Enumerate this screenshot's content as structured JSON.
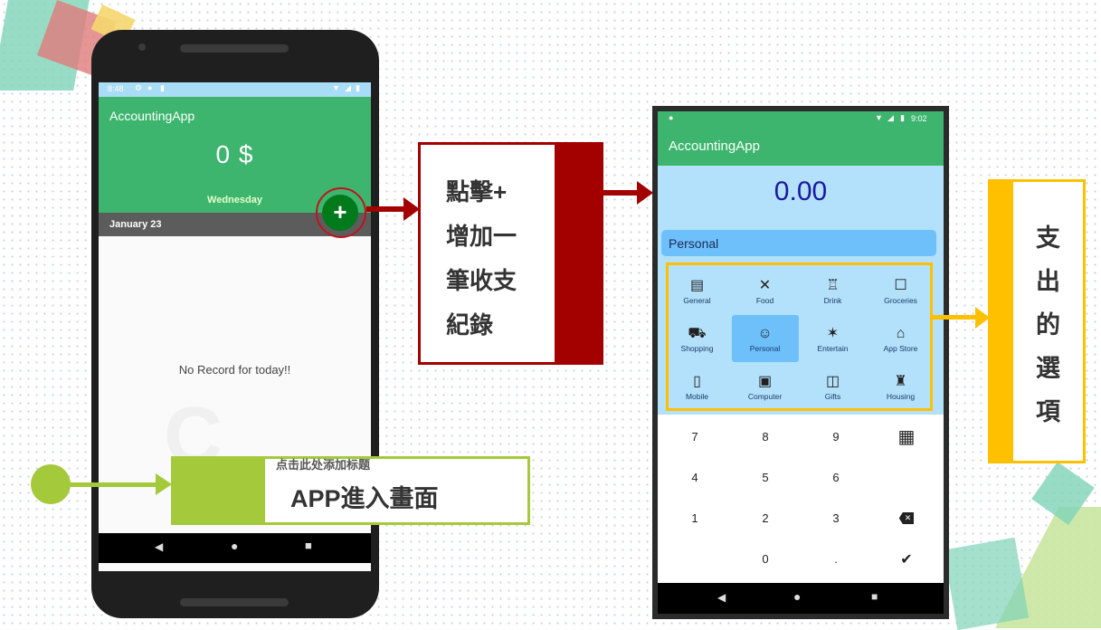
{
  "phone1": {
    "status_time": "8:48",
    "app_title": "AccountingApp",
    "amount": "0 $",
    "weekday": "Wednesday",
    "date": "January 23",
    "fab_label": "+",
    "empty_text": "No Record for today!!"
  },
  "callout_plus": {
    "lines": [
      "點擊+",
      "增加一",
      "筆收支",
      "紀錄"
    ]
  },
  "callout_enter": {
    "placeholder": "点击此处添加标题",
    "text": "APP進入畫面"
  },
  "phone2": {
    "status_time": "9:02",
    "app_title": "AccountingApp",
    "amount": "0.00",
    "selected_category": "Personal",
    "categories": [
      {
        "label": "General",
        "icon": "newspaper-icon"
      },
      {
        "label": "Food",
        "icon": "utensils-icon"
      },
      {
        "label": "Drink",
        "icon": "drink-icon"
      },
      {
        "label": "Groceries",
        "icon": "box-icon"
      },
      {
        "label": "Shopping",
        "icon": "cart-icon"
      },
      {
        "label": "Personal",
        "icon": "person-icon"
      },
      {
        "label": "Entertain",
        "icon": "sparkle-icon"
      },
      {
        "label": "App Store",
        "icon": "store-icon"
      },
      {
        "label": "Mobile",
        "icon": "mobile-icon"
      },
      {
        "label": "Computer",
        "icon": "computer-icon"
      },
      {
        "label": "Gifts",
        "icon": "gift-icon"
      },
      {
        "label": "Housing",
        "icon": "housing-icon"
      }
    ],
    "keys": [
      "7",
      "8",
      "9",
      "",
      "4",
      "5",
      "6",
      "",
      "1",
      "2",
      "3",
      "",
      "",
      "0",
      ".",
      ""
    ]
  },
  "callout_options": {
    "chars": [
      "支",
      "出",
      "的",
      "選",
      "項"
    ]
  },
  "colors": {
    "green": "#3db56e",
    "dark_red": "#a30000",
    "lime": "#a4c93a",
    "gold": "#ffc000",
    "light_blue": "#b3e0fa"
  }
}
